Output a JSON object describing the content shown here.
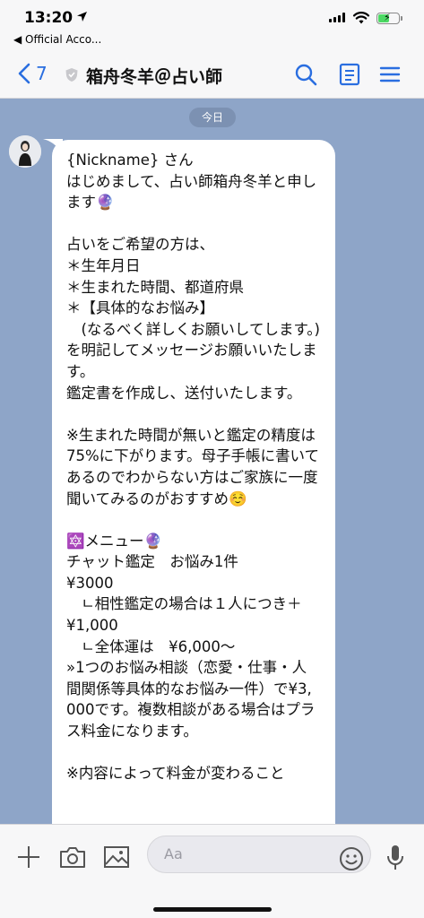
{
  "status_bar": {
    "time": "13:20",
    "back_app": "◀ Official Acco...",
    "battery_level": 0.55,
    "battery_color": "#4cd964"
  },
  "header": {
    "back_count": "7",
    "title": "箱舟冬羊＠占い師",
    "icons": [
      "chevron-left-icon",
      "shield-icon",
      "search-icon",
      "notes-icon",
      "menu-icon"
    ],
    "accent_color": "#2a6ee0"
  },
  "chat": {
    "date_label": "今日",
    "message": "{Nickname} さん\nはじめまして、占い師箱舟冬羊と申します🔮\n\n占いをご希望の方は、\n＊生年月日\n＊生まれた時間、都道府県\n＊【具体的なお悩み】\n　(なるべく詳しくお願いしてします。)\nを明記してメッセージお願いいたします。\n鑑定書を作成し、送付いたします。\n\n※生まれた時間が無いと鑑定の精度は75%に下がります。母子手帳に書いてあるのでわからない方はご家族に一度聞いてみるのがおすすめ☺️\n\n🔯メニュー🔮\nチャット鑑定　お悩み1件\n¥3000\n　ㄴ相性鑑定の場合は１人につき＋¥1,000\n　ㄴ全体運は　¥6,000～\n»1つのお悩み相談（恋愛・仕事・人間関係等具体的なお悩み一件）で¥3,000です。複数相談がある場合はプラス料金になります。\n\n※内容によって料金が変わること"
  },
  "input_bar": {
    "placeholder": "Aa",
    "icons": [
      "plus-icon",
      "camera-icon",
      "image-icon",
      "emoji-icon",
      "microphone-icon"
    ]
  }
}
